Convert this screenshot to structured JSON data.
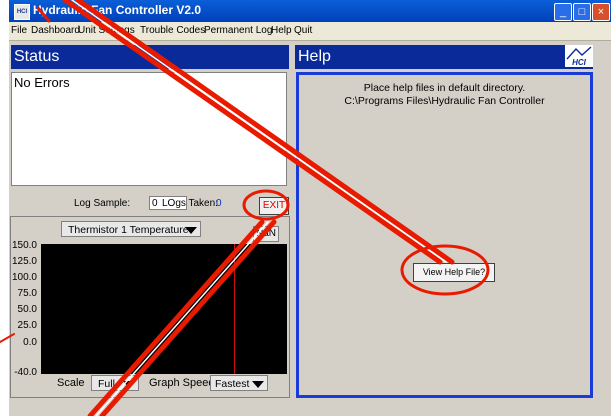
{
  "window": {
    "title": "Hydraulic Fan Controller V2.0",
    "app_icon": "HCI",
    "min_label": "_",
    "max_label": "□",
    "close_label": "×"
  },
  "menu": {
    "items": [
      "File",
      "Dashboard",
      "Unit Settings",
      "Trouble Codes",
      "Permanent Log",
      "Help",
      "Quit"
    ]
  },
  "status_panel": {
    "title": "Status",
    "message": "No Errors"
  },
  "log": {
    "sample_label": "Log Sample:",
    "sample_value": "0",
    "taken_label": "LOgs Taken:",
    "taken_value": "0",
    "exit_label": "EXIT"
  },
  "graph": {
    "sensor_select": "Thermistor 1 Temperature",
    "current_value": "NaN",
    "y_ticks": [
      "150.0",
      "125.0",
      "100.0",
      "75.0",
      "50.0",
      "25.0",
      "0.0",
      "-40.0"
    ],
    "scale_label": "Scale",
    "scale_value": "Full",
    "speed_label": "Graph Speed",
    "speed_value": "Fastest"
  },
  "help_panel": {
    "title": "Help",
    "line1": "Place help files in default directory.",
    "line2": "C:\\Programs Files\\Hydraulic Fan Controller",
    "view_button": "View Help File?",
    "logo_text": "HCI"
  },
  "colors": {
    "title_blue": "#0a2a9a",
    "annotation_red": "#e81a00",
    "help_border": "#1a3bd8"
  }
}
